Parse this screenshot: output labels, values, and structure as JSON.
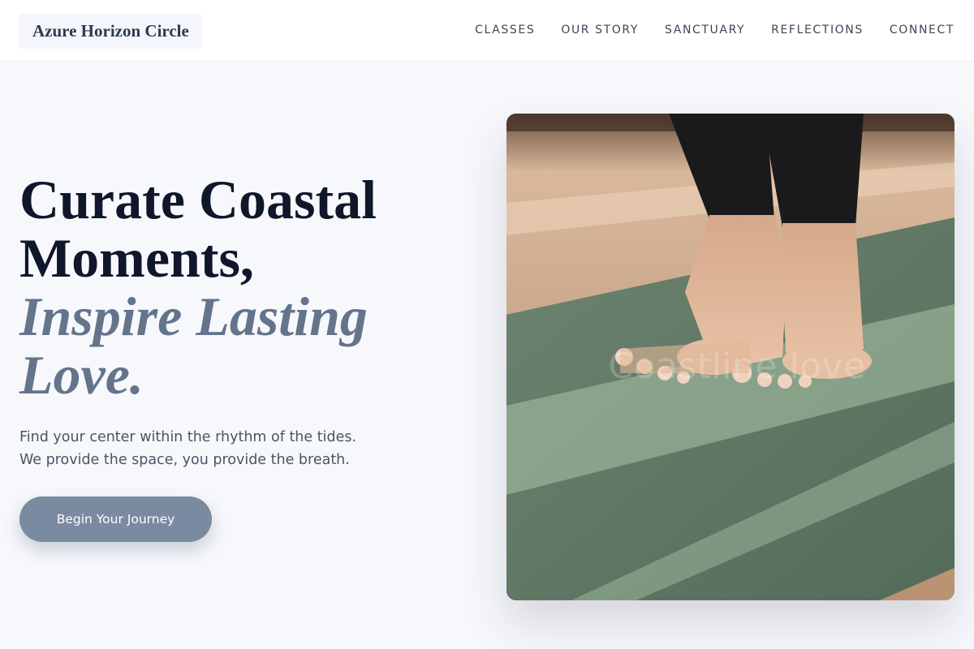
{
  "brand": {
    "name": "Azure Horizon Circle"
  },
  "nav": {
    "items": [
      {
        "label": "CLASSES"
      },
      {
        "label": "OUR STORY"
      },
      {
        "label": "SANCTUARY"
      },
      {
        "label": "REFLECTIONS"
      },
      {
        "label": "CONNECT"
      }
    ]
  },
  "hero": {
    "title_line1": "Curate Coastal",
    "title_line2": "Moments,",
    "title_line3": "Inspire Lasting",
    "title_line4": "Love.",
    "subtitle_line1": "Find your center within the rhythm of the tides.",
    "subtitle_line2": "We provide the space, you provide the breath.",
    "cta_label": "Begin Your Journey"
  },
  "image": {
    "watermark": "Coastline love"
  },
  "colors": {
    "background": "#f7f8fc",
    "heading": "#0f172a",
    "accent_text": "#64748b",
    "button": "#7a8aa0",
    "mat_green": "#5f7663"
  }
}
